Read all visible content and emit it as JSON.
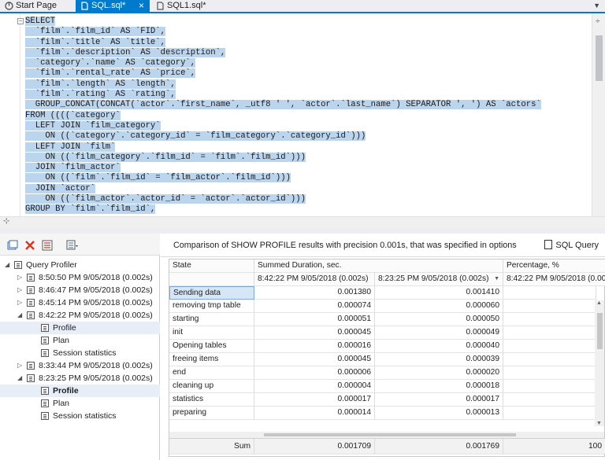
{
  "tabs": [
    {
      "label": "Start Page",
      "icon": "start-page-icon",
      "active": false
    },
    {
      "label": "SQL.sql*",
      "icon": "sql-file-icon",
      "active": true,
      "close": "×"
    },
    {
      "label": "SQL1.sql*",
      "icon": "sql-file-icon",
      "active": false
    }
  ],
  "editor": {
    "lines": [
      "SELECT",
      "  `film`.`film_id` AS `FID`,",
      "  `film`.`title` AS `title`,",
      "  `film`.`description` AS `description`,",
      "  `category`.`name` AS `category`,",
      "  `film`.`rental_rate` AS `price`,",
      "  `film`.`length` AS `length`,",
      "  `film`.`rating` AS `rating`,",
      "  GROUP_CONCAT(CONCAT(`actor`.`first_name`, _utf8 ' ', `actor`.`last_name`) SEPARATOR ', ') AS `actors`",
      "FROM ((((`category`",
      "  LEFT JOIN `film_category`",
      "    ON ((`category`.`category_id` = `film_category`.`category_id`)))",
      "  LEFT JOIN `film`",
      "    ON ((`film_category`.`film_id` = `film`.`film_id`)))",
      "  JOIN `film_actor`",
      "    ON ((`film`.`film_id` = `film_actor`.`film_id`)))",
      "  JOIN `actor`",
      "    ON ((`film_actor`.`actor_id` = `actor`.`actor_id`)))",
      "GROUP BY `film`.`film_id`,"
    ],
    "selection_color": "#bcd5ee"
  },
  "profiler": {
    "toolbar": [
      "new-profile-icon",
      "delete-icon",
      "compare-icon",
      "layout-dropdown-icon"
    ],
    "tree": [
      {
        "label": "Query Profiler",
        "level": 0,
        "expander": "◢",
        "icon": "profiler-icon"
      },
      {
        "label": "8:50:50 PM 9/05/2018 (0.002s)",
        "level": 1,
        "expander": "▷",
        "icon": "session-icon"
      },
      {
        "label": "8:46:47 PM 9/05/2018 (0.002s)",
        "level": 1,
        "expander": "▷",
        "icon": "session-icon"
      },
      {
        "label": "8:45:14 PM 9/05/2018 (0.002s)",
        "level": 1,
        "expander": "▷",
        "icon": "session-icon"
      },
      {
        "label": "8:42:22 PM 9/05/2018 (0.002s)",
        "level": 1,
        "expander": "◢",
        "icon": "session-icon"
      },
      {
        "label": "Profile",
        "level": 2,
        "expander": "",
        "icon": "profile-icon",
        "selected": true
      },
      {
        "label": "Plan",
        "level": 2,
        "expander": "",
        "icon": "plan-icon"
      },
      {
        "label": "Session statistics",
        "level": 2,
        "expander": "",
        "icon": "statistics-icon"
      },
      {
        "label": "8:33:44 PM 9/05/2018 (0.002s)",
        "level": 1,
        "expander": "▷",
        "icon": "session-icon"
      },
      {
        "label": "8:23:25 PM 9/05/2018 (0.002s)",
        "level": 1,
        "expander": "◢",
        "icon": "session-icon"
      },
      {
        "label": "Profile",
        "level": 2,
        "expander": "",
        "icon": "profile-icon",
        "selected": true,
        "bold": true
      },
      {
        "label": "Plan",
        "level": 2,
        "expander": "",
        "icon": "plan-icon"
      },
      {
        "label": "Session statistics",
        "level": 2,
        "expander": "",
        "icon": "statistics-icon"
      }
    ]
  },
  "comparison": {
    "title": "Comparison of SHOW PROFILE results with precision 0.001s, that was specified in options",
    "sql_query_label": "SQL Query",
    "header_state": "State",
    "header_summed": "Summed Duration, sec.",
    "header_percentage": "Percentage, %",
    "sub_col1": "8:42:22 PM 9/05/2018 (0.002s)",
    "sub_col2": "8:23:25 PM 9/05/2018 (0.002s)",
    "sub_col3": "8:42:22 PM 9/05/2018 (0.00",
    "rows": [
      {
        "state": "Sending data",
        "v1": "0.001380",
        "v2": "0.001410",
        "active": true
      },
      {
        "state": "removing tmp table",
        "v1": "0.000074",
        "v2": "0.000060"
      },
      {
        "state": "starting",
        "v1": "0.000051",
        "v2": "0.000050"
      },
      {
        "state": "init",
        "v1": "0.000045",
        "v2": "0.000049"
      },
      {
        "state": "Opening tables",
        "v1": "0.000016",
        "v2": "0.000040"
      },
      {
        "state": "freeing items",
        "v1": "0.000045",
        "v2": "0.000039"
      },
      {
        "state": "end",
        "v1": "0.000006",
        "v2": "0.000020"
      },
      {
        "state": "cleaning up",
        "v1": "0.000004",
        "v2": "0.000018"
      },
      {
        "state": "statistics",
        "v1": "0.000017",
        "v2": "0.000017"
      },
      {
        "state": "preparing",
        "v1": "0.000014",
        "v2": "0.000013"
      }
    ],
    "footer": {
      "label": "Sum",
      "v1": "0.001709",
      "v2": "0.001769",
      "pct": "100"
    }
  },
  "colors": {
    "accent": "#007acc",
    "selection": "#bcd5ee"
  }
}
